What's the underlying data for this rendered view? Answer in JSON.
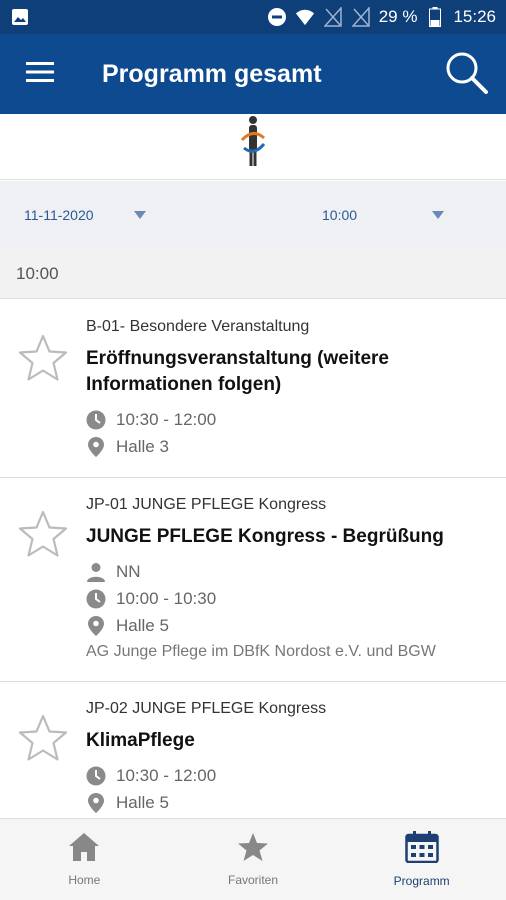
{
  "status_bar": {
    "battery_percent": "29 %",
    "time": "15:26",
    "icons": [
      "image-icon",
      "do-not-disturb-icon",
      "wifi-icon",
      "no-signal-icon",
      "no-signal-icon",
      "battery-icon"
    ]
  },
  "app_bar": {
    "title": "Programm gesamt",
    "menu_icon": "hamburger-menu-icon",
    "search_icon": "search-icon"
  },
  "filters": {
    "date": "11-11-2020",
    "time": "10:00"
  },
  "section": {
    "time_header": "10:00"
  },
  "sessions": [
    {
      "category": "B-01- Besondere Veranstaltung",
      "title_line1": "Eröffnungsveranstaltung (weitere",
      "title_line2": "Informationen folgen)",
      "time": "10:30 - 12:00",
      "location": "Halle 3"
    },
    {
      "category": "JP-01 JUNGE PFLEGE Kongress",
      "title": "JUNGE PFLEGE Kongress - Begrüßung",
      "speaker": "NN",
      "time": "10:00 - 10:30",
      "location": "Halle 5",
      "organizer": "AG Junge Pflege im DBfK Nordost e.V. und BGW"
    },
    {
      "category": "JP-02 JUNGE PFLEGE Kongress",
      "title": "KlimaPflege",
      "time": "10:30 - 12:00",
      "location": "Halle 5"
    }
  ],
  "bottom_nav": [
    {
      "label": "Home",
      "icon": "home-icon"
    },
    {
      "label": "Favoriten",
      "icon": "star-icon"
    },
    {
      "label": "Programm",
      "icon": "calendar-icon",
      "active": true
    }
  ],
  "colors": {
    "status_bar": "#0e3f78",
    "app_bar": "#0e4a8f",
    "filter_text": "#2a5a95",
    "active_nav": "#1d3f73"
  }
}
